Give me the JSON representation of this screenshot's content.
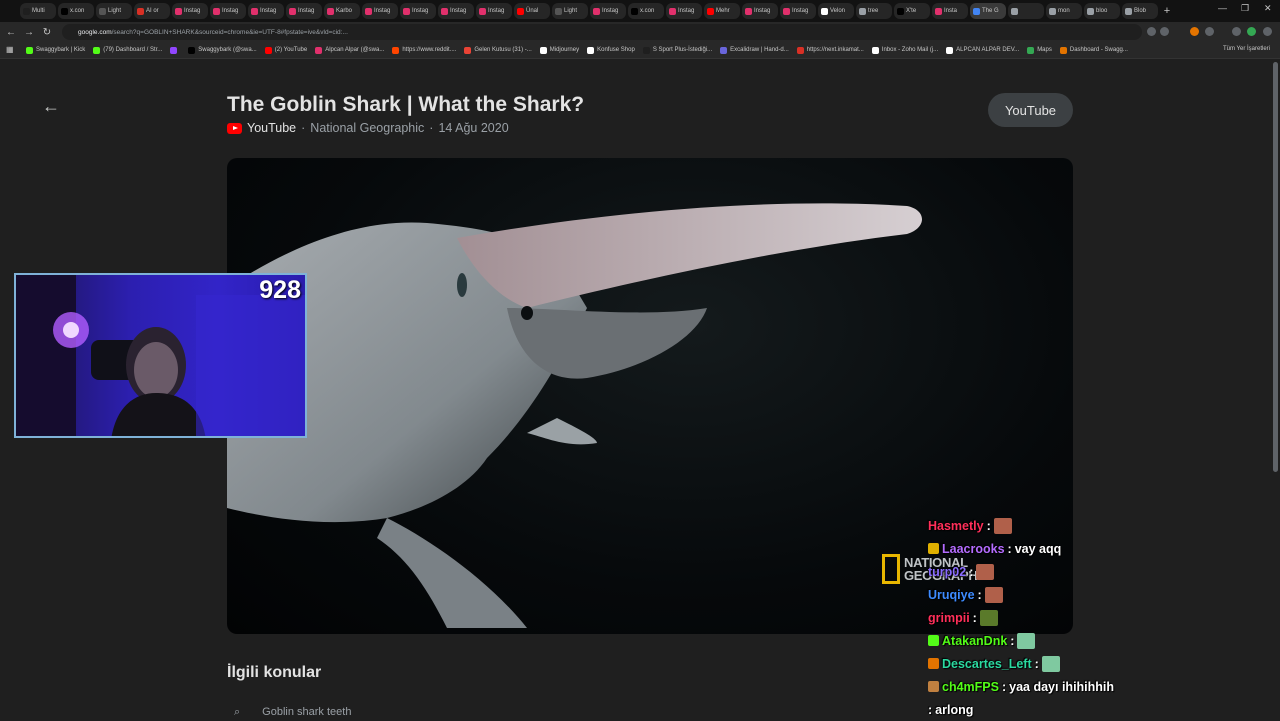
{
  "browser": {
    "tabs": [
      {
        "label": "Multi",
        "color": "#1f1f1f"
      },
      {
        "label": "x.con",
        "color": "#000000"
      },
      {
        "label": "Light",
        "color": "#555555"
      },
      {
        "label": "AI or",
        "color": "#d93025"
      },
      {
        "label": "Instag",
        "color": "#e1306c"
      },
      {
        "label": "Instag",
        "color": "#e1306c"
      },
      {
        "label": "Instag",
        "color": "#e1306c"
      },
      {
        "label": "Instag",
        "color": "#e1306c"
      },
      {
        "label": "Karbo",
        "color": "#e1306c"
      },
      {
        "label": "Instag",
        "color": "#e1306c"
      },
      {
        "label": "Instag",
        "color": "#e1306c"
      },
      {
        "label": "Instag",
        "color": "#e1306c"
      },
      {
        "label": "Instag",
        "color": "#e1306c"
      },
      {
        "label": "Ünal",
        "color": "#ff0000"
      },
      {
        "label": "Light",
        "color": "#555555"
      },
      {
        "label": "Instag",
        "color": "#e1306c"
      },
      {
        "label": "x.con",
        "color": "#000000"
      },
      {
        "label": "Instag",
        "color": "#e1306c"
      },
      {
        "label": "Mehr",
        "color": "#ff0000"
      },
      {
        "label": "Instag",
        "color": "#e1306c"
      },
      {
        "label": "Instag",
        "color": "#e1306c"
      },
      {
        "label": "Velon",
        "color": "#ffffff"
      },
      {
        "label": "tree",
        "color": "#9aa0a6"
      },
      {
        "label": "X'te",
        "color": "#000000"
      },
      {
        "label": "Insta",
        "color": "#e1306c"
      },
      {
        "label": "The G",
        "color": "#4285f4"
      },
      {
        "label": "",
        "color": "#9aa0a6"
      },
      {
        "label": "mon",
        "color": "#9aa0a6"
      },
      {
        "label": "bloo",
        "color": "#9aa0a6"
      },
      {
        "label": "Blob",
        "color": "#9aa0a6"
      }
    ],
    "url_host": "google.com",
    "url_rest": "/search?q=GOBLIN+SHARK&sourceid=chrome&ie=UTF-8#fpstate=ive&vld=cid:...",
    "bookmarks": [
      {
        "label": "Swaggybark | Kick",
        "color": "#53fc18"
      },
      {
        "label": "(79) Dashboard / Str...",
        "color": "#53fc18"
      },
      {
        "label": "",
        "color": "#9146ff"
      },
      {
        "label": "Swaggybark (@swa...",
        "color": "#000000"
      },
      {
        "label": "(2) YouTube",
        "color": "#ff0000"
      },
      {
        "label": "Alpcan Alpar (@swa...",
        "color": "#e1306c"
      },
      {
        "label": "https://www.reddit....",
        "color": "#ff4500"
      },
      {
        "label": "Gelen Kutusu (31) -...",
        "color": "#ea4335"
      },
      {
        "label": "Midjourney",
        "color": "#ffffff"
      },
      {
        "label": "Konfuse Shop",
        "color": "#ffffff"
      },
      {
        "label": "S Sport Plus-İstediği...",
        "color": "#1f1f1f"
      },
      {
        "label": "Excalidraw | Hand-d...",
        "color": "#6965db"
      },
      {
        "label": "https://next.inkamat...",
        "color": "#d93025"
      },
      {
        "label": "Inbox - Zoho Mail (j...",
        "color": "#ffffff"
      },
      {
        "label": "ALPCAN ALPAR DEV...",
        "color": "#ffffff"
      },
      {
        "label": "Maps",
        "color": "#34a853"
      },
      {
        "label": "Dashboard - Swagg...",
        "color": "#e37400"
      }
    ],
    "all_bookmarks_label": "Tüm Yer İşaretleri"
  },
  "page": {
    "title": "The Goblin Shark | What the Shark?",
    "source": "YouTube",
    "channel": "National Geographic",
    "date": "14 Ağu 2020",
    "youtube_button": "YouTube",
    "watermark_line1": "NATIONAL",
    "watermark_line2": "GEOGRAPHIC",
    "related_title": "İlgili konular",
    "related_first": "Goblin shark teeth"
  },
  "overlay": {
    "viewer_count": "928",
    "chat": [
      {
        "user": "Hasmetly",
        "color": "#ff2f5a",
        "text": "",
        "emote": "#b0604a",
        "badge": ""
      },
      {
        "user": "Laacrooks",
        "color": "#b46cff",
        "text": "vay aqq",
        "emote": "",
        "badge": "#e0b000"
      },
      {
        "user": "turp02",
        "color": "#8a6cff",
        "text": "",
        "emote": "#b0604a",
        "badge": ""
      },
      {
        "user": "Uruqiye",
        "color": "#3d8bff",
        "text": "",
        "emote": "#b0604a",
        "badge": ""
      },
      {
        "user": "grimpii",
        "color": "#ff2f5a",
        "text": "",
        "emote": "#5a7a2a",
        "badge": ""
      },
      {
        "user": "AtakanDnk",
        "color": "#53fc18",
        "text": "",
        "emote": "#7fc9a0",
        "badge": "#53fc18"
      },
      {
        "user": "Descartes_Left",
        "color": "#2bd9a0",
        "text": "",
        "emote": "#7fc9a0",
        "badge": "#e37400"
      },
      {
        "user": "ch4mFPS",
        "color": "#53fc18",
        "text": "yaa dayı ihihihhih",
        "emote": "",
        "badge": "#c08040"
      },
      {
        "user": "",
        "color": "#ffffff",
        "text": "arlong",
        "emote": "",
        "badge": ""
      }
    ]
  },
  "colors": {
    "page_bg": "#1f1f1f",
    "accent_red": "#ff0000",
    "ng_yellow": "#e8b600"
  }
}
